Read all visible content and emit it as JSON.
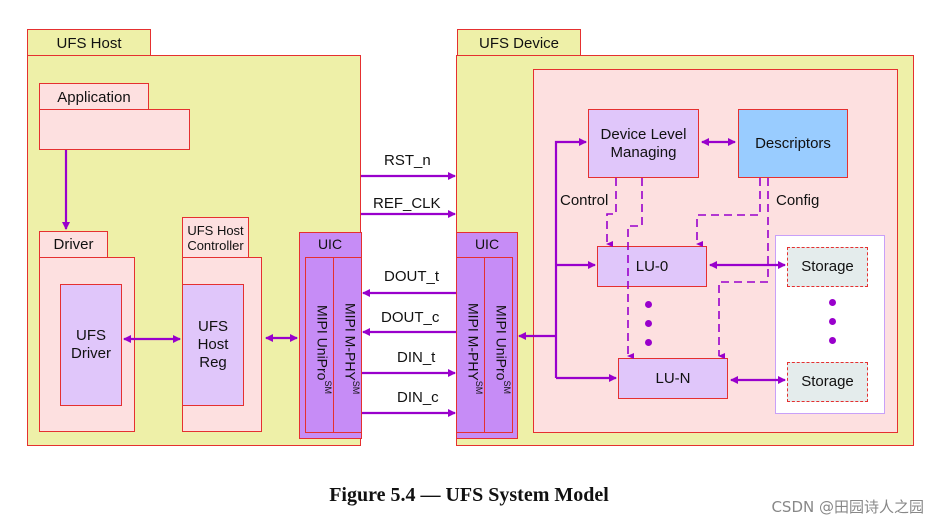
{
  "host": {
    "title": "UFS Host",
    "application": "Application",
    "driver_tab": "Driver",
    "driver_inner": "UFS Driver",
    "controller_tab": "UFS Host Controller",
    "host_reg": "UFS Host Reg",
    "uic": {
      "title": "UIC",
      "unipro": "MIPI UniPro",
      "mphy": "MIPI M-PHY",
      "sup": "SM"
    }
  },
  "signals": [
    {
      "name": "RST_n",
      "direction": "to-device"
    },
    {
      "name": "REF_CLK",
      "direction": "to-device"
    },
    {
      "name": "DOUT_t",
      "direction": "to-host"
    },
    {
      "name": "DOUT_c",
      "direction": "to-host"
    },
    {
      "name": "DIN_t",
      "direction": "to-device"
    },
    {
      "name": "DIN_c",
      "direction": "to-device"
    }
  ],
  "device": {
    "title": "UFS Device",
    "uic": {
      "title": "UIC",
      "mphy": "MIPI M-PHY",
      "unipro": "MIPI UniPro",
      "sup": "SM"
    },
    "device_level_managing": "Device Level Managing",
    "descriptors": "Descriptors",
    "control_label": "Control",
    "config_label": "Config",
    "lu0": "LU-0",
    "lun": "LU-N",
    "storage": [
      "Storage",
      "Storage"
    ]
  },
  "caption": "Figure 5.4 — UFS System Model",
  "watermark": "CSDN @田园诗人之园",
  "colors": {
    "border": "#e53030",
    "arrow": "#9900cc",
    "host_bg": "#eef0a8",
    "pink_bg": "#fde0e0",
    "lavender": "#e0c6fa",
    "uic_purple": "#c68cf6",
    "descriptors_blue": "#99ccff",
    "storage_grey": "#e4ecec"
  }
}
